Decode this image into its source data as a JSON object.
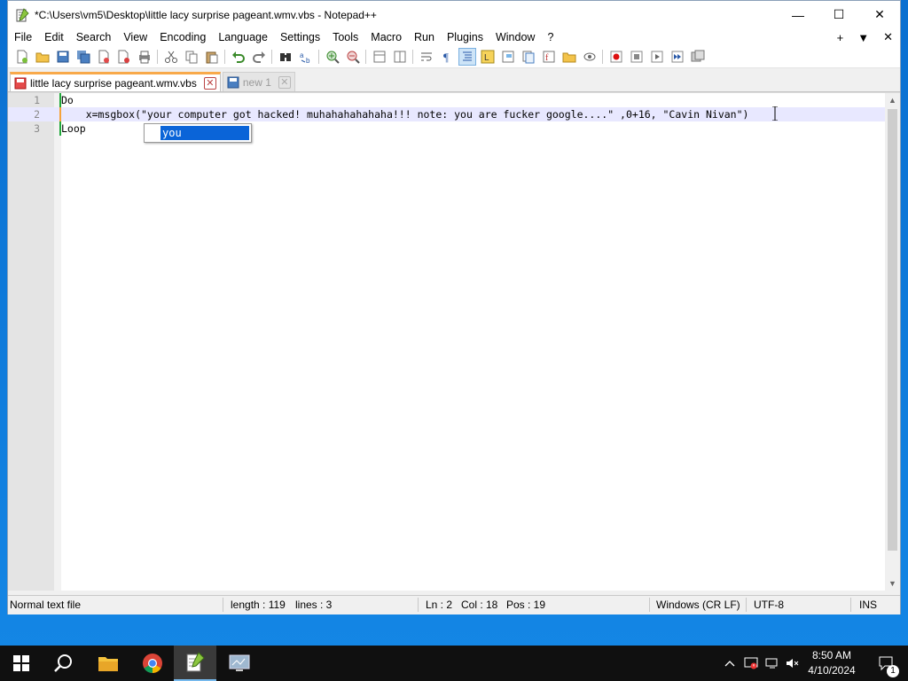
{
  "window": {
    "title": "*C:\\Users\\vm5\\Desktop\\little lacy surprise pageant.wmv.vbs - Notepad++",
    "controls": {
      "minimize": "—",
      "maximize": "☐",
      "close": "✕"
    }
  },
  "menu": {
    "items": [
      "File",
      "Edit",
      "Search",
      "View",
      "Encoding",
      "Language",
      "Settings",
      "Tools",
      "Macro",
      "Run",
      "Plugins",
      "Window",
      "?"
    ],
    "right_controls": [
      "+",
      "▼",
      "✕"
    ]
  },
  "tabs": [
    {
      "label": "little lacy surprise pageant.wmv.vbs",
      "active": true
    },
    {
      "label": "new 1",
      "active": false
    }
  ],
  "editor": {
    "lines": [
      {
        "number": "1",
        "text": "Do"
      },
      {
        "number": "2",
        "text": "    x=msgbox(\"your computer got hacked! muhahahahahaha!!! note: you are fucker google....\" ,0+16, \"Cavin Nivan\")"
      },
      {
        "number": "3",
        "text": "Loop"
      }
    ],
    "autocomplete_suggestion": "you"
  },
  "status": {
    "file_type": "Normal text file",
    "length": "length : 119",
    "lines": "lines : 3",
    "ln": "Ln : 2",
    "col": "Col : 18",
    "pos": "Pos : 19",
    "eol": "Windows (CR LF)",
    "encoding": "UTF-8",
    "mode": "INS"
  },
  "taskbar": {
    "time": "8:50 AM",
    "date": "4/10/2024",
    "notification_count": "1",
    "apps": [
      "start-icon",
      "search-icon",
      "file-explorer-icon",
      "chrome-icon",
      "notepadpp-icon",
      "system-app-icon"
    ]
  },
  "colors": {
    "accent_tab": "#f8a94a",
    "selection": "#0a64d8",
    "current_line": "#e8e8ff"
  }
}
